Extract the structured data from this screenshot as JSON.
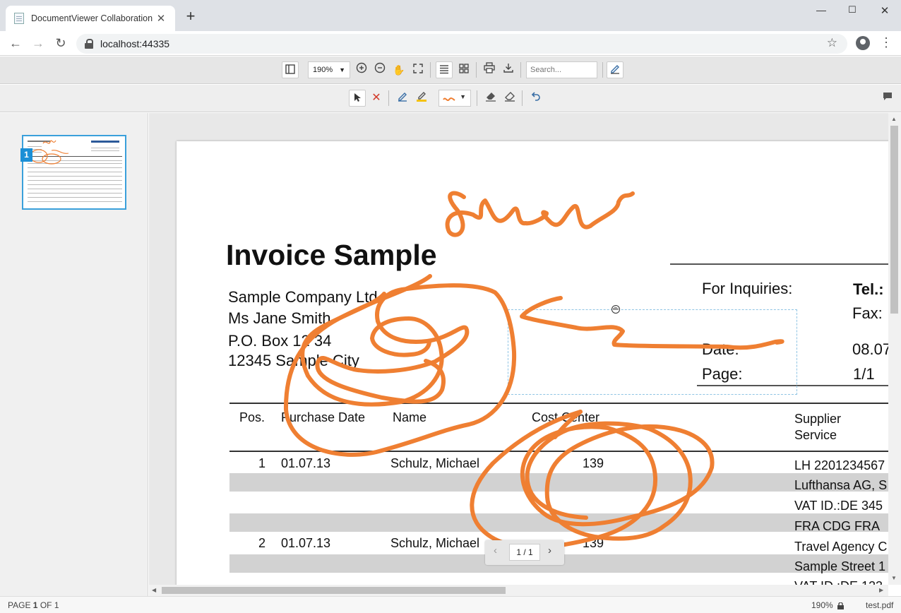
{
  "browser": {
    "tab_title": "DocumentViewer Collaboration",
    "url": "localhost:44335"
  },
  "toolbar": {
    "zoom": "190%",
    "search_placeholder": "Search..."
  },
  "thumbnail": {
    "page_number": "1"
  },
  "document": {
    "title": "Invoice Sample",
    "address": [
      "Sample Company Ltd.",
      "Ms Jane Smith",
      "P.O. Box 12 34",
      "12345 Sample City"
    ],
    "inquiries_label": "For Inquiries:",
    "tel_label": "Tel.:",
    "fax_label": "Fax:",
    "date_label": "Date:",
    "date_value": "08.07",
    "page_label": "Page:",
    "page_value": "1/1",
    "columns": {
      "pos": "Pos.",
      "purchase_date": "Purchase Date",
      "name": "Name",
      "cost_center": "Cost Center",
      "supplier_line1": "Supplier",
      "supplier_line2": "Service"
    },
    "rows": [
      {
        "pos": "1",
        "date": "01.07.13",
        "name": "Schulz, Michael",
        "cost_center": "139"
      },
      {
        "pos": "2",
        "date": "01.07.13",
        "name": "Schulz, Michael",
        "cost_center": "139"
      }
    ],
    "supplier_lines": [
      "LH 2201234567",
      "Lufthansa AG, S",
      "VAT ID.:DE 345",
      "FRA CDG FRA",
      "Travel Agency C",
      "Sample Street 1",
      "VAT ID.:DE 123"
    ]
  },
  "pager": {
    "text": "1 / 1"
  },
  "status": {
    "page_prefix": "PAGE ",
    "page_current": "1",
    "page_suffix": " OF 1",
    "zoom": "190%",
    "filename": "test.pdf"
  },
  "colors": {
    "ink": "#ef7f32",
    "selection": "#8fc4e4",
    "thumb_border": "#3aa0db"
  }
}
